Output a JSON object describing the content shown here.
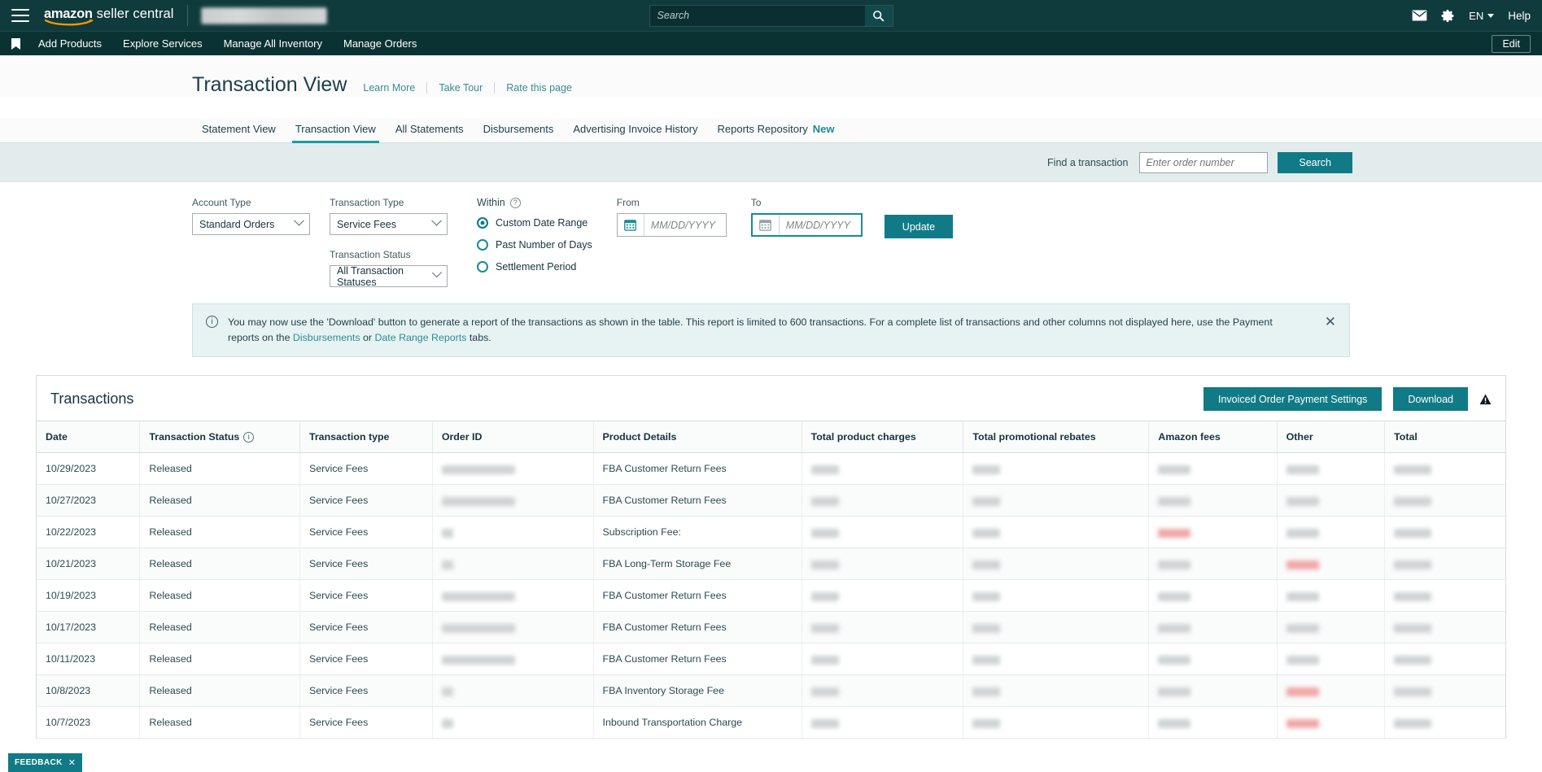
{
  "header": {
    "brand_amazon": "amazon",
    "brand_seller_central": "seller central",
    "search_placeholder": "Search",
    "language": "EN",
    "help": "Help",
    "icons": {
      "menu": "hamburger-icon",
      "mail": "mail-icon",
      "gear": "gear-icon",
      "search": "search-icon"
    }
  },
  "subnav": {
    "items": [
      {
        "label": "Add Products"
      },
      {
        "label": "Explore Services"
      },
      {
        "label": "Manage All Inventory"
      },
      {
        "label": "Manage Orders"
      }
    ],
    "edit_label": "Edit"
  },
  "page": {
    "title": "Transaction View",
    "links": [
      "Learn More",
      "Take Tour",
      "Rate this page"
    ]
  },
  "tabs": [
    {
      "label": "Statement View",
      "active": false
    },
    {
      "label": "Transaction View",
      "active": true
    },
    {
      "label": "All Statements",
      "active": false
    },
    {
      "label": "Disbursements",
      "active": false
    },
    {
      "label": "Advertising Invoice History",
      "active": false
    },
    {
      "label": "Reports Repository",
      "active": false,
      "badge": "New"
    }
  ],
  "find": {
    "label": "Find a transaction",
    "placeholder": "Enter order number",
    "button": "Search"
  },
  "filters": {
    "account_type": {
      "label": "Account Type",
      "value": "Standard Orders"
    },
    "transaction_type": {
      "label": "Transaction Type",
      "value": "Service Fees"
    },
    "transaction_status": {
      "label": "Transaction Status",
      "value": "All Transaction Statuses"
    },
    "within": {
      "label": "Within",
      "options": [
        "Custom Date Range",
        "Past Number of Days",
        "Settlement Period"
      ],
      "selected": "Custom Date Range"
    },
    "from": {
      "label": "From",
      "placeholder": "MM/DD/YYYY",
      "value": ""
    },
    "to": {
      "label": "To",
      "placeholder": "MM/DD/YYYY",
      "value": ""
    },
    "update_button": "Update"
  },
  "banner": {
    "text_part1": "You may now use the 'Download' button to generate a report of the transactions as shown in the table. This report is limited to 600 transactions. For a complete list of transactions and other columns not displayed here, use the Payment reports on the ",
    "link1": "Disbursements",
    "text_mid": " or ",
    "link2": "Date Range Reports",
    "text_end": " tabs.",
    "close": "✕"
  },
  "table_panel": {
    "title": "Transactions",
    "invoiced_button": "Invoiced Order Payment Settings",
    "download_button": "Download",
    "warning_icon": "warning-triangle-icon"
  },
  "table": {
    "columns": [
      {
        "key": "date",
        "label": "Date"
      },
      {
        "key": "status",
        "label": "Transaction Status",
        "info": true
      },
      {
        "key": "type",
        "label": "Transaction type"
      },
      {
        "key": "order_id",
        "label": "Order ID"
      },
      {
        "key": "product_details",
        "label": "Product Details"
      },
      {
        "key": "total_product_charges",
        "label": "Total product charges"
      },
      {
        "key": "total_promotional_rebates",
        "label": "Total promotional rebates"
      },
      {
        "key": "amazon_fees",
        "label": "Amazon fees"
      },
      {
        "key": "other",
        "label": "Other"
      },
      {
        "key": "total",
        "label": "Total"
      }
    ],
    "rows": [
      {
        "date": "10/29/2023",
        "status": "Released",
        "type": "Service Fees",
        "order_id": "",
        "order_id_redacted": true,
        "order_id_width": 90,
        "product_details": "FBA Customer Return Fees",
        "total_product_charges": "",
        "total_promotional_rebates": "",
        "amazon_fees": "",
        "other": "",
        "total": "",
        "negatives": []
      },
      {
        "date": "10/27/2023",
        "status": "Released",
        "type": "Service Fees",
        "order_id": "",
        "order_id_redacted": true,
        "order_id_width": 90,
        "product_details": "FBA Customer Return Fees",
        "total_product_charges": "",
        "total_promotional_rebates": "",
        "amazon_fees": "",
        "other": "",
        "total": "",
        "negatives": []
      },
      {
        "date": "10/22/2023",
        "status": "Released",
        "type": "Service Fees",
        "order_id": "",
        "order_id_redacted": true,
        "order_id_width": 14,
        "product_details": "Subscription Fee:",
        "total_product_charges": "",
        "total_promotional_rebates": "",
        "amazon_fees": "",
        "other": "",
        "total": "",
        "negatives": [
          "amazon_fees"
        ]
      },
      {
        "date": "10/21/2023",
        "status": "Released",
        "type": "Service Fees",
        "order_id": "",
        "order_id_redacted": true,
        "order_id_width": 14,
        "product_details": "FBA Long-Term Storage Fee",
        "total_product_charges": "",
        "total_promotional_rebates": "",
        "amazon_fees": "",
        "other": "",
        "total": "",
        "negatives": [
          "other"
        ]
      },
      {
        "date": "10/19/2023",
        "status": "Released",
        "type": "Service Fees",
        "order_id": "",
        "order_id_redacted": true,
        "order_id_width": 90,
        "product_details": "FBA Customer Return Fees",
        "total_product_charges": "",
        "total_promotional_rebates": "",
        "amazon_fees": "",
        "other": "",
        "total": "",
        "negatives": []
      },
      {
        "date": "10/17/2023",
        "status": "Released",
        "type": "Service Fees",
        "order_id": "",
        "order_id_redacted": true,
        "order_id_width": 90,
        "product_details": "FBA Customer Return Fees",
        "total_product_charges": "",
        "total_promotional_rebates": "",
        "amazon_fees": "",
        "other": "",
        "total": "",
        "negatives": []
      },
      {
        "date": "10/11/2023",
        "status": "Released",
        "type": "Service Fees",
        "order_id": "",
        "order_id_redacted": true,
        "order_id_width": 90,
        "product_details": "FBA Customer Return Fees",
        "total_product_charges": "",
        "total_promotional_rebates": "",
        "amazon_fees": "",
        "other": "",
        "total": "",
        "negatives": []
      },
      {
        "date": "10/8/2023",
        "status": "Released",
        "type": "Service Fees",
        "order_id": "",
        "order_id_redacted": true,
        "order_id_width": 14,
        "product_details": "FBA Inventory Storage Fee",
        "total_product_charges": "",
        "total_promotional_rebates": "",
        "amazon_fees": "",
        "other": "",
        "total": "",
        "negatives": [
          "other"
        ]
      },
      {
        "date": "10/7/2023",
        "status": "Released",
        "type": "Service Fees",
        "order_id": "",
        "order_id_redacted": true,
        "order_id_width": 14,
        "product_details": "Inbound Transportation Charge",
        "total_product_charges": "",
        "total_promotional_rebates": "",
        "amazon_fees": "",
        "other": "",
        "total": "",
        "negatives": [
          "other"
        ]
      }
    ]
  },
  "feedback": {
    "label": "FEEDBACK",
    "close": "✕"
  },
  "colors": {
    "nav_bg": "#0F3B3C",
    "subnav_bg": "#0B3233",
    "accent": "#107b86",
    "tab_underline": "#1a9ba3",
    "link": "#2b8e98",
    "banner_bg": "#e7f2f3",
    "filter_strip_bg": "#e3ecec"
  }
}
